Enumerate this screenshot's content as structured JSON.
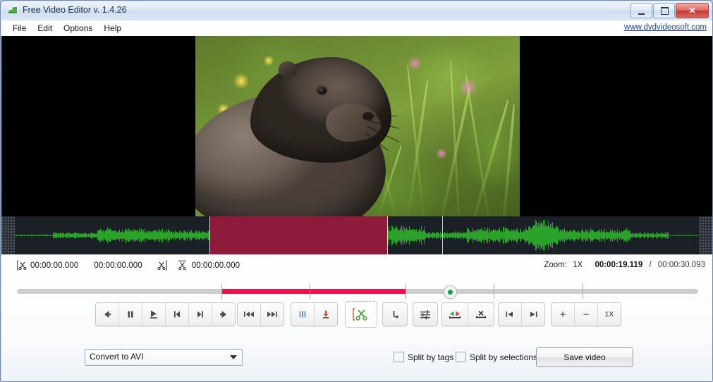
{
  "window": {
    "title": "Free Video Editor v. 1.4.26",
    "app_icon": "video-editor-icon",
    "buttons": {
      "minimize": "minimize-button",
      "maximize": "maximize-button",
      "close_label": "✕"
    }
  },
  "menu": {
    "items": [
      {
        "label": "File"
      },
      {
        "label": "Edit"
      },
      {
        "label": "Options"
      },
      {
        "label": "Help"
      }
    ],
    "site_link": "www.dvdvideosoft.com"
  },
  "timeline": {
    "mark_in": "00:00:00.000",
    "selection_duration": "00:00:00.000",
    "mark_out": "00:00:00.000",
    "zoom_label": "Zoom:",
    "zoom_value": "1X",
    "current_time": "00:00:19.119",
    "separator": "/",
    "total_time": "00:00:30.093",
    "selection_start_pct": 30.0,
    "selection_end_pct": 57.0,
    "playhead_pct": 63.5,
    "ticks_pct": [
      30.0,
      43.0,
      57.0,
      70.0,
      83.0
    ],
    "waveform_selection_start_pct": 28.5,
    "waveform_selection_end_pct": 54.5,
    "waveform_playhead_pct": 62.5
  },
  "toolbar": {
    "transport": [
      {
        "name": "step-back-button",
        "icon": "arrow-left-icon"
      },
      {
        "name": "pause-button",
        "icon": "pause-icon"
      },
      {
        "name": "play-button",
        "icon": "play-on-line-icon"
      },
      {
        "name": "prev-frame-button",
        "icon": "skip-to-start-icon"
      },
      {
        "name": "next-frame-button",
        "icon": "skip-to-end-icon"
      },
      {
        "name": "step-forward-button",
        "icon": "arrow-right-icon"
      }
    ],
    "jump": [
      {
        "name": "jump-start-button",
        "icon": "rewind-icon"
      },
      {
        "name": "jump-end-button",
        "icon": "fast-forward-icon"
      }
    ],
    "marks": [
      {
        "name": "add-tag-button",
        "icon": "color-bars-icon"
      },
      {
        "name": "insert-marker-button",
        "icon": "arrow-down-to-line-icon"
      }
    ],
    "cut": {
      "name": "cut-selection-button",
      "icon": "scissors-bracket-icon"
    },
    "undo": {
      "name": "undo-button",
      "icon": "arrow-turn-up-icon"
    },
    "settings": {
      "name": "settings-button",
      "icon": "sliders-icon"
    },
    "selection_tools": [
      {
        "name": "invert-selection-button",
        "icon": "arrows-on-line-icon"
      },
      {
        "name": "delete-selection-button",
        "icon": "x-on-line-icon"
      }
    ],
    "nav": [
      {
        "name": "go-to-start-button",
        "icon": "arrow-left-to-bar-icon"
      },
      {
        "name": "go-to-end-button",
        "icon": "arrow-right-to-bar-icon"
      }
    ],
    "zoom": [
      {
        "name": "zoom-in-button",
        "icon": "plus-icon",
        "label": "+"
      },
      {
        "name": "zoom-out-button",
        "icon": "minus-icon",
        "label": "−"
      },
      {
        "name": "zoom-reset-button",
        "icon": "zoom-1x-icon",
        "label": "1X"
      }
    ]
  },
  "footer": {
    "format_value": "Convert to AVI",
    "split_by_tags": "Split by tags",
    "split_by_tags_checked": false,
    "split_by_selections": "Split by selections",
    "split_by_selections_checked": false,
    "save_label": "Save video"
  },
  "colors": {
    "accent_red": "#f4104c",
    "selection_red": "#8f1b3c",
    "waveform_green": "#2ba32b",
    "waveform_selected": "#b0703a",
    "link_blue": "#1e3f8f",
    "app_green": "#44aa44"
  }
}
